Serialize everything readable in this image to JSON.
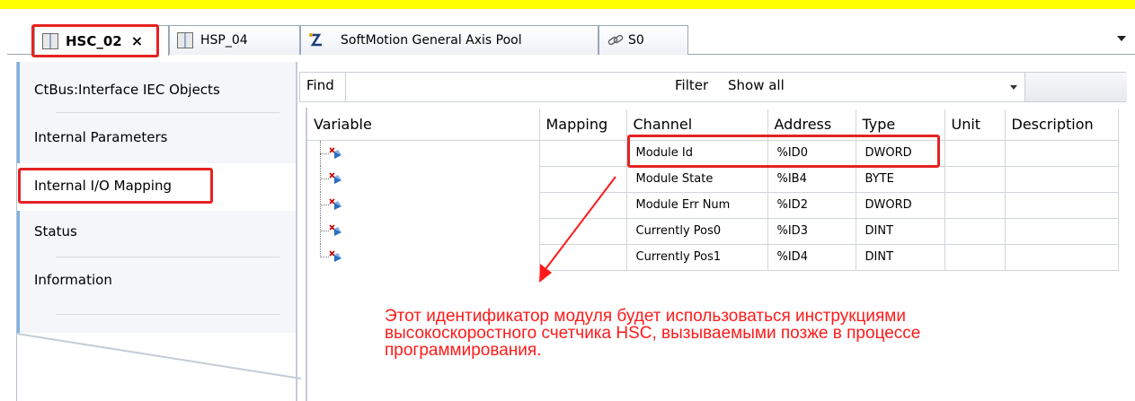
{
  "tabs": [
    {
      "label": "HSC_02",
      "icon": "module-icon",
      "active": true,
      "close": "×"
    },
    {
      "label": "HSP_04",
      "icon": "module-icon",
      "active": false
    },
    {
      "label": "SoftMotion General Axis Pool",
      "icon": "axis-pool-icon",
      "active": false
    },
    {
      "label": "S0",
      "icon": "link-icon",
      "active": false
    }
  ],
  "sidebar": {
    "items": [
      {
        "label": "CtBus:Interface IEC Objects"
      },
      {
        "label": "Internal Parameters"
      },
      {
        "label": "Internal I/O Mapping",
        "selected": true
      },
      {
        "label": "Status"
      },
      {
        "label": "Information"
      }
    ]
  },
  "findbar": {
    "find_label": "Find",
    "filter_label": "Filter",
    "filter_value": "Show all"
  },
  "table": {
    "columns": [
      "Variable",
      "Mapping",
      "Channel",
      "Address",
      "Type",
      "Unit",
      "Description"
    ],
    "rows": [
      {
        "variable": "",
        "mapping": "",
        "channel": "Module Id",
        "address": "%ID0",
        "type": "DWORD",
        "unit": "",
        "description": ""
      },
      {
        "variable": "",
        "mapping": "",
        "channel": "Module State",
        "address": "%IB4",
        "type": "BYTE",
        "unit": "",
        "description": ""
      },
      {
        "variable": "",
        "mapping": "",
        "channel": "Module Err Num",
        "address": "%ID2",
        "type": "DWORD",
        "unit": "",
        "description": ""
      },
      {
        "variable": "",
        "mapping": "",
        "channel": "Currently Pos0",
        "address": "%ID3",
        "type": "DINT",
        "unit": "",
        "description": ""
      },
      {
        "variable": "",
        "mapping": "",
        "channel": "Currently Pos1",
        "address": "%ID4",
        "type": "DINT",
        "unit": "",
        "description": ""
      }
    ]
  },
  "annotation": {
    "lines": [
      "Этот идентификатор модуля будет использоваться инструкциями",
      "высокоскоростного счетчика HSC, вызываемыми позже в процессе",
      "программирования."
    ]
  },
  "colors": {
    "highlight_bar": "#ffff00",
    "annotation_red": "#ff1a1a",
    "accent_blue": "#7fb0e8"
  }
}
